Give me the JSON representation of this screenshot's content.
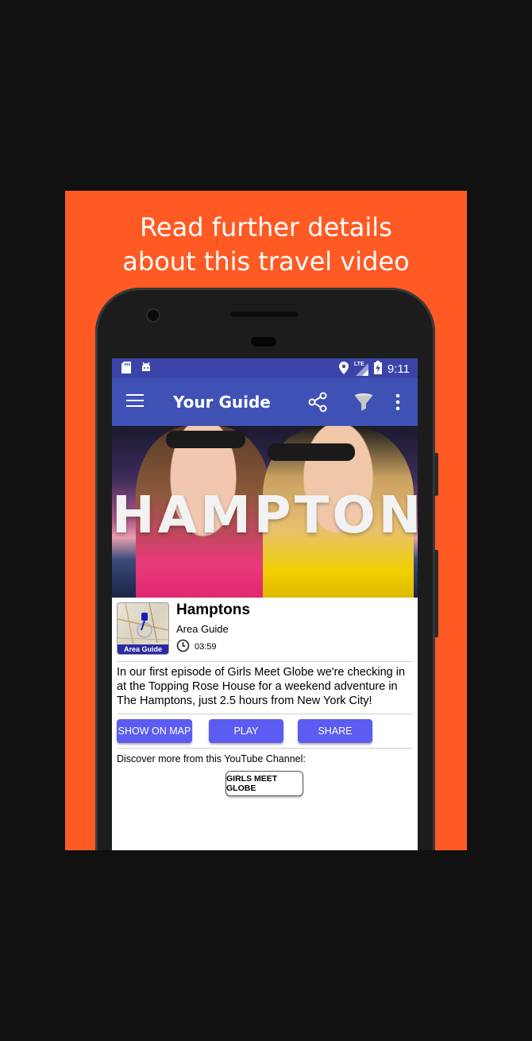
{
  "promo": {
    "headline_line1": "Read further details",
    "headline_line2": "about this travel video",
    "background": "#ff5a24"
  },
  "statusbar": {
    "time": "9:11",
    "network": "LTE",
    "icons": [
      "sd-card-icon",
      "android-icon",
      "location-icon",
      "signal-icon",
      "battery-charging-icon"
    ]
  },
  "appbar": {
    "title": "Your Guide",
    "color": "#3f51b5",
    "actions": [
      "menu-icon",
      "share-icon",
      "filter-icon",
      "more-vert-icon"
    ]
  },
  "hero": {
    "overlay_text": "HAMPTONS"
  },
  "video": {
    "title": "Hamptons",
    "category": "Area Guide",
    "duration": "03:59",
    "thumbnail_badge": "Area Guide",
    "description": "In our first episode of Girls Meet Globe we're checking in at the Topping Rose House for a weekend adventure in The Hamptons, just 2.5 hours from New York City!"
  },
  "actions": {
    "show_on_map": "SHOW ON MAP",
    "play": "PLAY",
    "share": "SHARE",
    "button_color": "#5c5cf2"
  },
  "channel": {
    "prompt": "Discover more from this YouTube Channel:",
    "name": "GIRLS MEET GLOBE"
  }
}
